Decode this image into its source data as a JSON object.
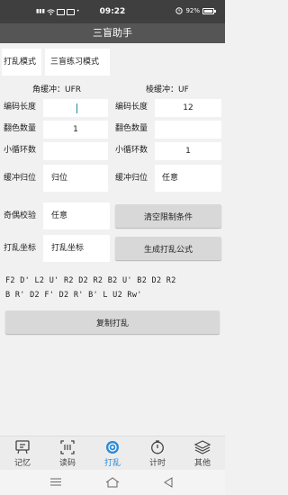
{
  "status_bar": {
    "time": "09:22",
    "battery": "92%",
    "left_icons": [
      "signal-icon",
      "wifi-icon",
      "message-icon",
      "media-icon",
      "dot-icon"
    ],
    "right_icons": [
      "alarm-icon",
      "battery-icon"
    ]
  },
  "app": {
    "title": "三盲助手"
  },
  "mode": {
    "label": "打乱模式",
    "value": "三盲练习模式"
  },
  "buffers": {
    "corner": "角缓冲：UFR",
    "edge": "棱缓冲：UF"
  },
  "corner_settings": {
    "length_label": "编码长度",
    "length_value": "",
    "flip_label": "翻色数量",
    "flip_value": "1",
    "cycle_label": "小循环数",
    "cycle_value": "",
    "home_label": "缓冲归位",
    "home_value": "归位"
  },
  "edge_settings": {
    "length_label": "编码长度",
    "length_value": "12",
    "flip_label": "翻色数量",
    "flip_value": "",
    "cycle_label": "小循环数",
    "cycle_value": "1",
    "home_label": "缓冲归位",
    "home_value": "任意"
  },
  "parity": {
    "label": "奇偶校验",
    "value": "任意"
  },
  "coords": {
    "label": "打乱坐标",
    "value": "打乱坐标"
  },
  "buttons": {
    "clear": "清空限制条件",
    "generate": "生成打乱公式",
    "copy": "复制打乱"
  },
  "scramble": {
    "line1": "F2 D' L2 U' R2 D2 R2 B2 U' B2 D2 R2",
    "line2": "B R' D2 F' D2 R' B' L U2 Rw'"
  },
  "nav": [
    {
      "label": "记忆",
      "icon": "memory-icon"
    },
    {
      "label": "读码",
      "icon": "scan-icon"
    },
    {
      "label": "打乱",
      "icon": "scramble-icon",
      "active": true
    },
    {
      "label": "计时",
      "icon": "timer-icon"
    },
    {
      "label": "其他",
      "icon": "layers-icon"
    }
  ],
  "colors": {
    "title_bar": "#555555",
    "status_bar": "#3f3f3f",
    "active_nav": "#2b8ad8",
    "cursor": "#1e88a8"
  }
}
